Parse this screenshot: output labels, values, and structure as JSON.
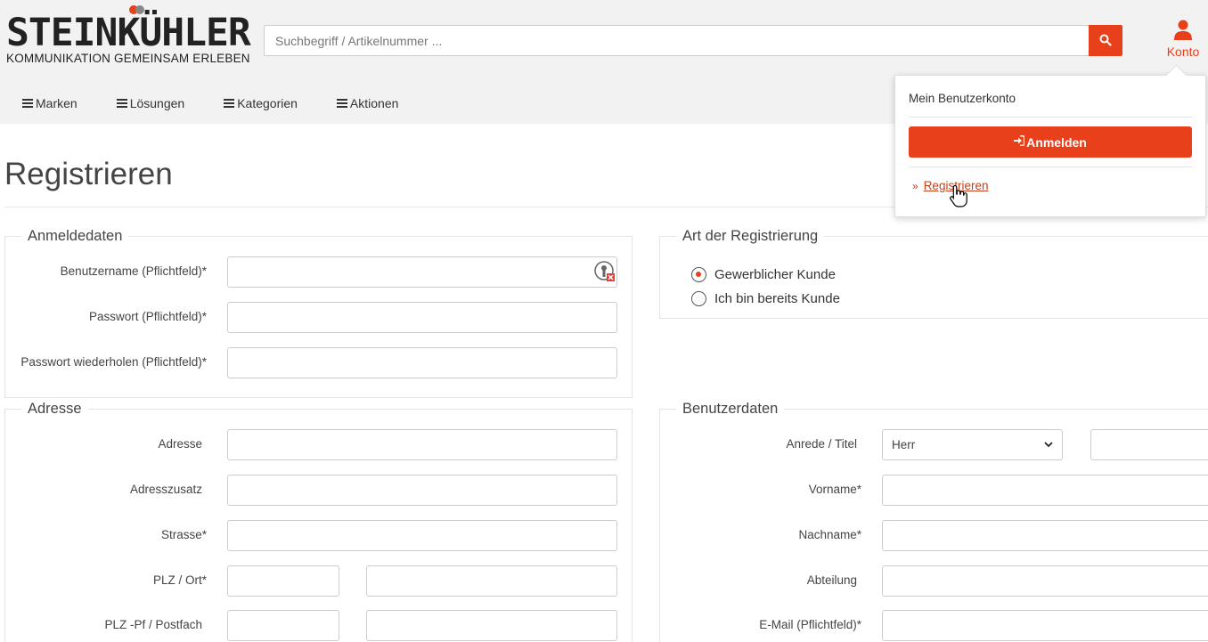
{
  "header": {
    "logo_main": "STEINKÜHLER",
    "logo_sub": "KOMMUNIKATION GEMEINSAM ERLEBEN",
    "search_placeholder": "Suchbegriff / Artikelnummer ...",
    "account_label": "Konto",
    "brand_color": "#e8401a"
  },
  "nav": {
    "items": [
      {
        "label": "Marken"
      },
      {
        "label": "Lösungen"
      },
      {
        "label": "Kategorien"
      },
      {
        "label": "Aktionen"
      }
    ]
  },
  "account_dropdown": {
    "title": "Mein Benutzerkonto",
    "login_label": "Anmelden",
    "register_link": "Registrieren"
  },
  "page": {
    "title": "Registrieren"
  },
  "login_data": {
    "legend": "Anmeldedaten",
    "username_label": "Benutzername (Pflichtfeld)*",
    "password_label": "Passwort (Pflichtfeld)*",
    "password_repeat_label": "Passwort wiederholen (Pflichtfeld)*"
  },
  "registration_type": {
    "legend": "Art der Registrierung",
    "options": [
      {
        "label": "Gewerblicher Kunde",
        "selected": true
      },
      {
        "label": "Ich bin bereits Kunde",
        "selected": false
      }
    ]
  },
  "address": {
    "legend": "Adresse",
    "address_label": "Adresse",
    "address_extra_label": "Adresszusatz",
    "street_label": "Strasse*",
    "zip_city_label": "PLZ / Ort*",
    "po_box_label": "PLZ -Pf / Postfach"
  },
  "user_data": {
    "legend": "Benutzerdaten",
    "salutation_label": "Anrede / Titel",
    "salutation_value": "Herr",
    "firstname_label": "Vorname*",
    "lastname_label": "Nachname*",
    "department_label": "Abteilung",
    "email_label": "E-Mail (Pflichtfeld)*"
  }
}
